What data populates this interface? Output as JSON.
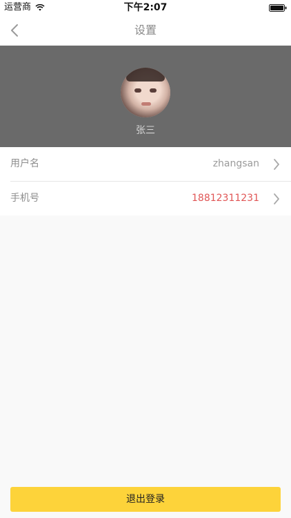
{
  "status_bar": {
    "carrier": "运营商",
    "time": "下午2:07",
    "icons": [
      "wifi-icon",
      "battery-icon"
    ]
  },
  "nav": {
    "title": "设置",
    "back_icon": "chevron-left-icon"
  },
  "profile": {
    "name": "张三"
  },
  "settings": {
    "rows": [
      {
        "label": "用户名",
        "value": "zhangsan",
        "value_color": "#9a9a9a"
      },
      {
        "label": "手机号",
        "value": "18812311231",
        "value_color": "#e05555"
      }
    ]
  },
  "actions": {
    "logout_label": "退出登录"
  },
  "colors": {
    "header_bg": "#6a6a6a",
    "accent_button": "#fdd33a",
    "phone_value": "#e05555"
  }
}
